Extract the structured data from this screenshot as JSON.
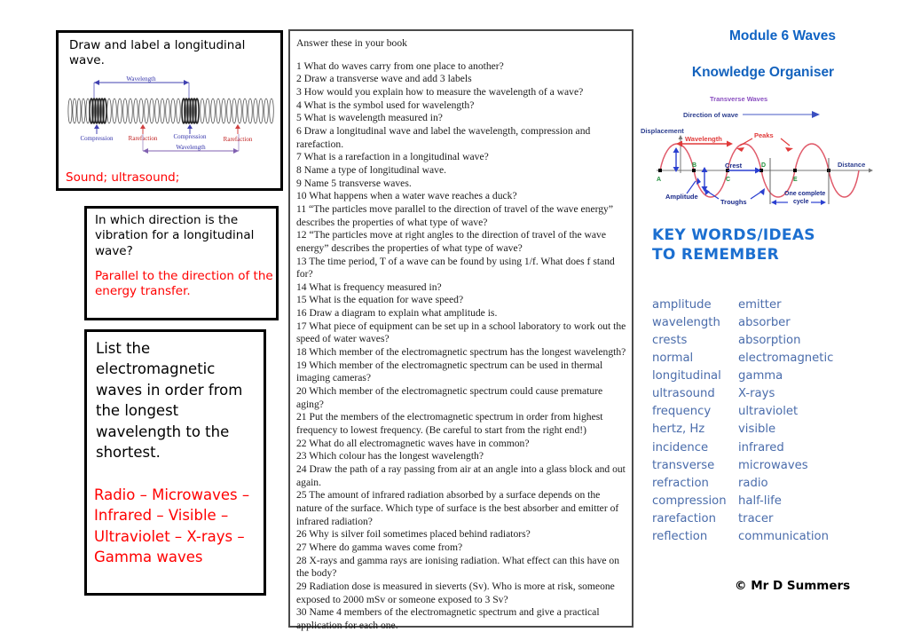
{
  "document": {
    "title_line1": "Module 6 Waves",
    "title_line2": "Knowledge Organiser",
    "copyright": "© Mr D Summers",
    "accent_blue": "#1362bd",
    "keyword_blue": "#4a6cab",
    "answer_red": "#ff0000"
  },
  "flashcards": [
    {
      "question": "Draw and label a longitudinal wave.",
      "answer": "Sound; ultrasound;",
      "diagram": {
        "name": "longitudinal-wave-diagram",
        "labels": [
          "Wavelength",
          "Compression",
          "Rarefaction",
          "Compression",
          "Rarefaction",
          "Wavelength"
        ]
      }
    },
    {
      "question": "In which direction is the vibration for a longitudinal wave?",
      "answer": " Parallel to the direction of the energy transfer."
    },
    {
      "question": "List the electromagnetic waves in order from the longest wavelength to the shortest.",
      "answer": " Radio – Microwaves – Infrared – Visible – Ultraviolet – X-rays – Gamma waves"
    }
  ],
  "questions_panel": {
    "heading": "Answer these in your book",
    "items": [
      "1 What do waves carry from one place to another?",
      "2 Draw a transverse wave and add 3 labels",
      "3 How would you explain how to measure the wavelength of a wave?",
      "4 What is the symbol used for wavelength?",
      "5 What is wavelength measured in?",
      "6 Draw a longitudinal wave and label the wavelength, compression and rarefaction.",
      "7 What is a rarefaction in a longitudinal wave?",
      "8 Name a type of longitudinal wave.",
      "9 Name 5 transverse waves.",
      "10 What happens when a water wave reaches a duck?",
      "11 “The particles move parallel to the direction of travel of the wave energy” describes the properties of what type of wave?",
      "12 “The particles move at right angles to the direction of travel of the wave energy” describes the properties of what type of wave?",
      "13 The time period, T of a wave can be found by using 1/f. What does f stand for?",
      "14 What is frequency measured in?",
      "15 What is the equation for wave speed?",
      "16 Draw a diagram to explain what amplitude is.",
      "17 What piece of equipment can be set up in a school laboratory to work out the speed of water waves?",
      "18 Which member of the electromagnetic spectrum has the longest wavelength?",
      "19 Which member of the electromagnetic spectrum can be used in thermal imaging cameras?",
      "20 Which member of the electromagnetic spectrum could cause premature aging?",
      "21 Put the members of the electromagnetic spectrum in order from highest frequency to lowest frequency. (Be careful to start from the right end!)",
      "22 What do all electromagnetic waves have in common?",
      "23 Which colour has the longest wavelength?",
      "24 Draw the path of a ray passing from air at an angle into a glass block and out again.",
      "25 The amount of infrared radiation absorbed by a surface depends on the nature of the surface. Which type of surface is the best absorber and emitter of infrared radiation?",
      "26 Why is silver foil sometimes placed behind radiators?",
      "27 Where do gamma waves come from?",
      "28 X-rays and gamma rays are ionising radiation. What effect can this have on the body?",
      "29 Radiation dose is measured in sieverts (Sv). Who is more at risk, someone exposed to 2000 mSv or someone exposed to 3 Sv?",
      "30 Name 4 members of the electromagnetic spectrum and give a practical application for each one."
    ]
  },
  "transverse_diagram": {
    "name": "transverse-wave-diagram",
    "title": "Transverse Waves",
    "direction_label": "Direction of wave",
    "y_axis_label": "Displacement",
    "x_axis_label": "Distance",
    "labels": [
      "Wavelength",
      "Peaks",
      "Crest",
      "Amplitude",
      "Troughs",
      "One complete cycle"
    ],
    "points": [
      "A",
      "B",
      "C",
      "D",
      "E"
    ]
  },
  "keywords": {
    "title_line1": "KEY WORDS/IDEAS",
    "title_line2": "TO REMEMBER",
    "rows": [
      [
        "amplitude",
        "emitter"
      ],
      [
        "wavelength",
        "absorber"
      ],
      [
        "crests",
        "absorption"
      ],
      [
        "normal",
        "electromagnetic"
      ],
      [
        "longitudinal",
        "gamma"
      ],
      [
        "ultrasound",
        "X-rays"
      ],
      [
        "frequency",
        "ultraviolet"
      ],
      [
        "hertz, Hz",
        "visible"
      ],
      [
        "incidence",
        "infrared"
      ],
      [
        "transverse",
        "microwaves"
      ],
      [
        "refraction",
        "radio"
      ],
      [
        "compression",
        "half-life"
      ],
      [
        "rarefaction",
        "tracer"
      ],
      [
        "reflection",
        "communication"
      ]
    ]
  }
}
